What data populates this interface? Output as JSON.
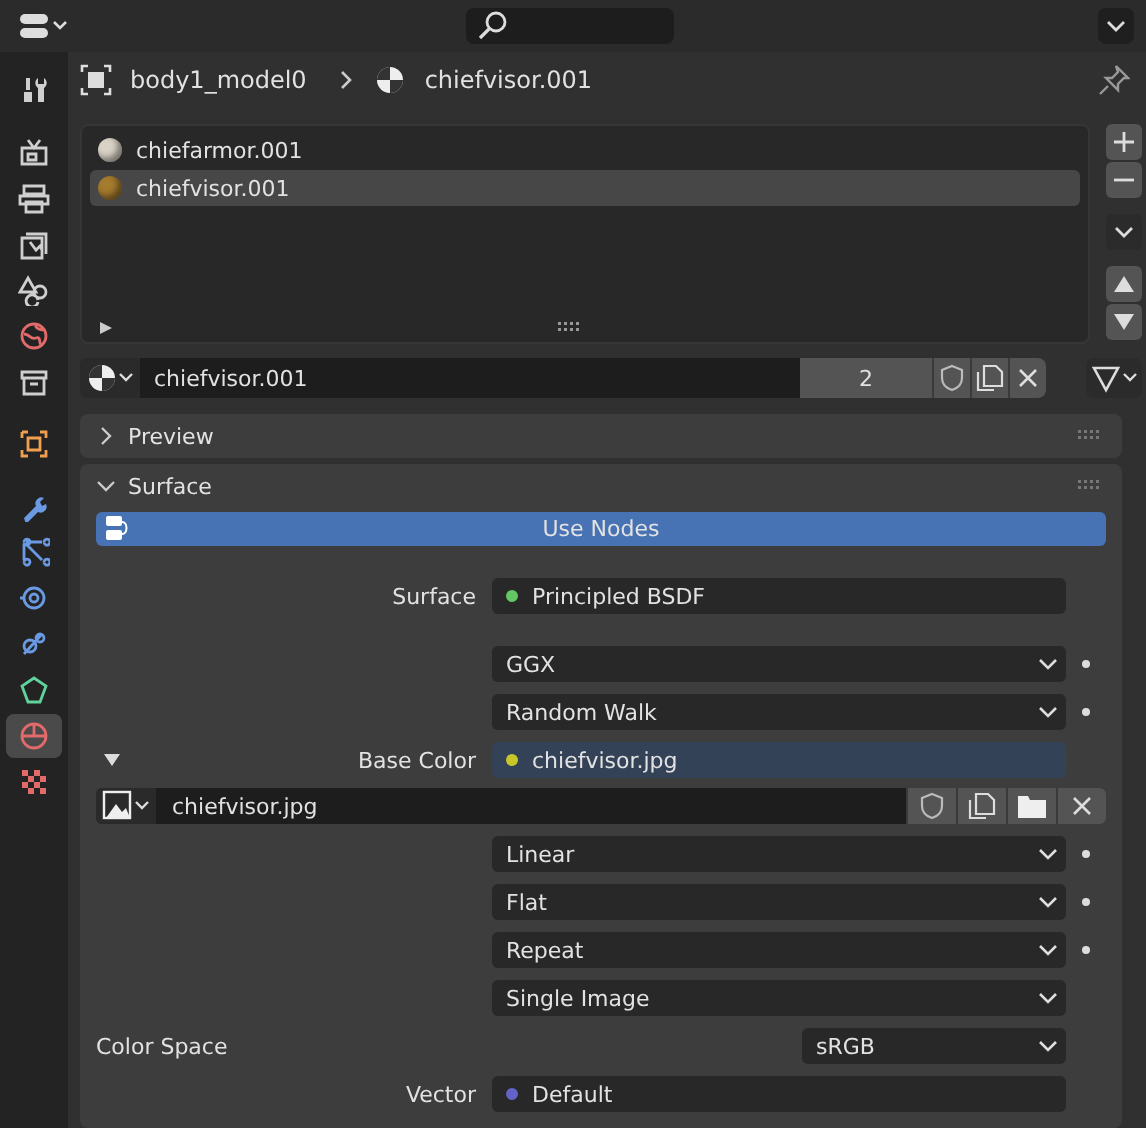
{
  "sidebar_tabs": [
    {
      "kind": "tool",
      "selected": false
    },
    {
      "kind": "render",
      "selected": false
    },
    {
      "kind": "output",
      "selected": false
    },
    {
      "kind": "view_layer",
      "selected": false
    },
    {
      "kind": "scene",
      "selected": false
    },
    {
      "kind": "world",
      "selected": false
    },
    {
      "kind": "collection",
      "selected": false
    },
    {
      "kind": "object",
      "selected": false
    },
    {
      "kind": "modifier",
      "selected": false
    },
    {
      "kind": "particles",
      "selected": false
    },
    {
      "kind": "physics",
      "selected": false
    },
    {
      "kind": "constraints",
      "selected": false
    },
    {
      "kind": "data",
      "selected": false
    },
    {
      "kind": "material",
      "selected": true
    },
    {
      "kind": "texture",
      "selected": false
    }
  ],
  "breadcrumb": [
    {
      "kind": "object",
      "label": "body1_model0"
    },
    {
      "kind": "material",
      "label": "chiefvisor.001"
    }
  ],
  "material_slots": [
    {
      "name": "chiefarmor.001",
      "color": "#d9d2c6",
      "selected": false
    },
    {
      "name": "chiefvisor.001",
      "color": "#a57b2e",
      "selected": true
    }
  ],
  "datablock": {
    "name": "chiefvisor.001",
    "users": "2"
  },
  "panels": [
    {
      "title": "Preview",
      "expanded": false
    },
    {
      "title": "Surface",
      "expanded": true
    }
  ],
  "use_nodes": {
    "label": "Use Nodes",
    "on": true
  },
  "rows": [
    {
      "kind": "socket",
      "label": "Surface",
      "value": "Principled BSDF",
      "color": "#63c763",
      "linked": false
    },
    {
      "kind": "dropdown",
      "value": "GGX",
      "dot": true
    },
    {
      "kind": "dropdown",
      "value": "Random Walk",
      "dot": true
    },
    {
      "kind": "socket",
      "label": "Base Color",
      "value": "chiefvisor.jpg",
      "color": "#c7c729",
      "linked": true,
      "expanded": true
    },
    {
      "kind": "image",
      "name": "chiefvisor.jpg"
    },
    {
      "kind": "dropdown",
      "value": "Linear",
      "dot": true
    },
    {
      "kind": "dropdown",
      "value": "Flat",
      "dot": true
    },
    {
      "kind": "dropdown",
      "value": "Repeat",
      "dot": true
    },
    {
      "kind": "dropdown",
      "value": "Single Image",
      "dot": false
    },
    {
      "kind": "wide",
      "label": "Color Space",
      "value": "sRGB"
    },
    {
      "kind": "socket",
      "label": "Vector",
      "value": "Default",
      "color": "#6363c7",
      "linked": false
    }
  ]
}
